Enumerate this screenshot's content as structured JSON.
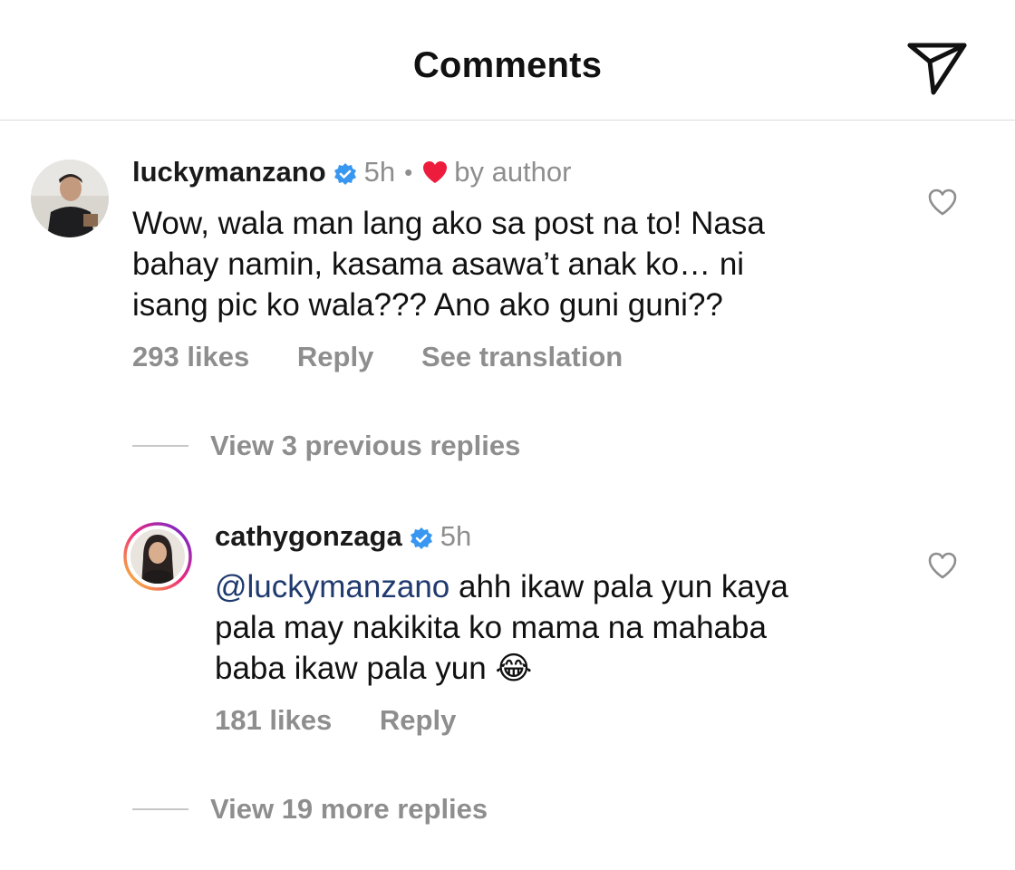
{
  "header": {
    "title": "Comments",
    "share_icon": "paper-plane-icon"
  },
  "colors": {
    "liked_heart": "#ed1c3c",
    "verified": "#3897f0",
    "muted": "#8e8e8e",
    "mention": "#1f3a6e",
    "story_ring": [
      "#f9ce34",
      "#ee2a7b",
      "#6228d7"
    ]
  },
  "comments": [
    {
      "username": "luckymanzano",
      "time": "5h",
      "separator": "•",
      "by_author": "by author",
      "body_lines": [
        "Wow, wala man lang ako sa post na to! Nasa",
        "bahay namin, kasama asawa’t anak ko… ni",
        "isang pic ko wala??? Ano ako guni guni??"
      ],
      "likes": "293 likes",
      "reply": "Reply",
      "see_translation": "See translation",
      "view_replies": "View 3 previous replies"
    },
    {
      "username": "cathygonzaga",
      "time": "5h",
      "mention": "@luckymanzano",
      "body_lines": [
        "ahh ikaw pala yun kaya",
        "pala may nakikita ko mama na mahaba",
        "baba ikaw pala yun"
      ],
      "emoji": "😂",
      "likes": "181 likes",
      "reply": "Reply",
      "view_replies": "View 19 more replies"
    }
  ]
}
